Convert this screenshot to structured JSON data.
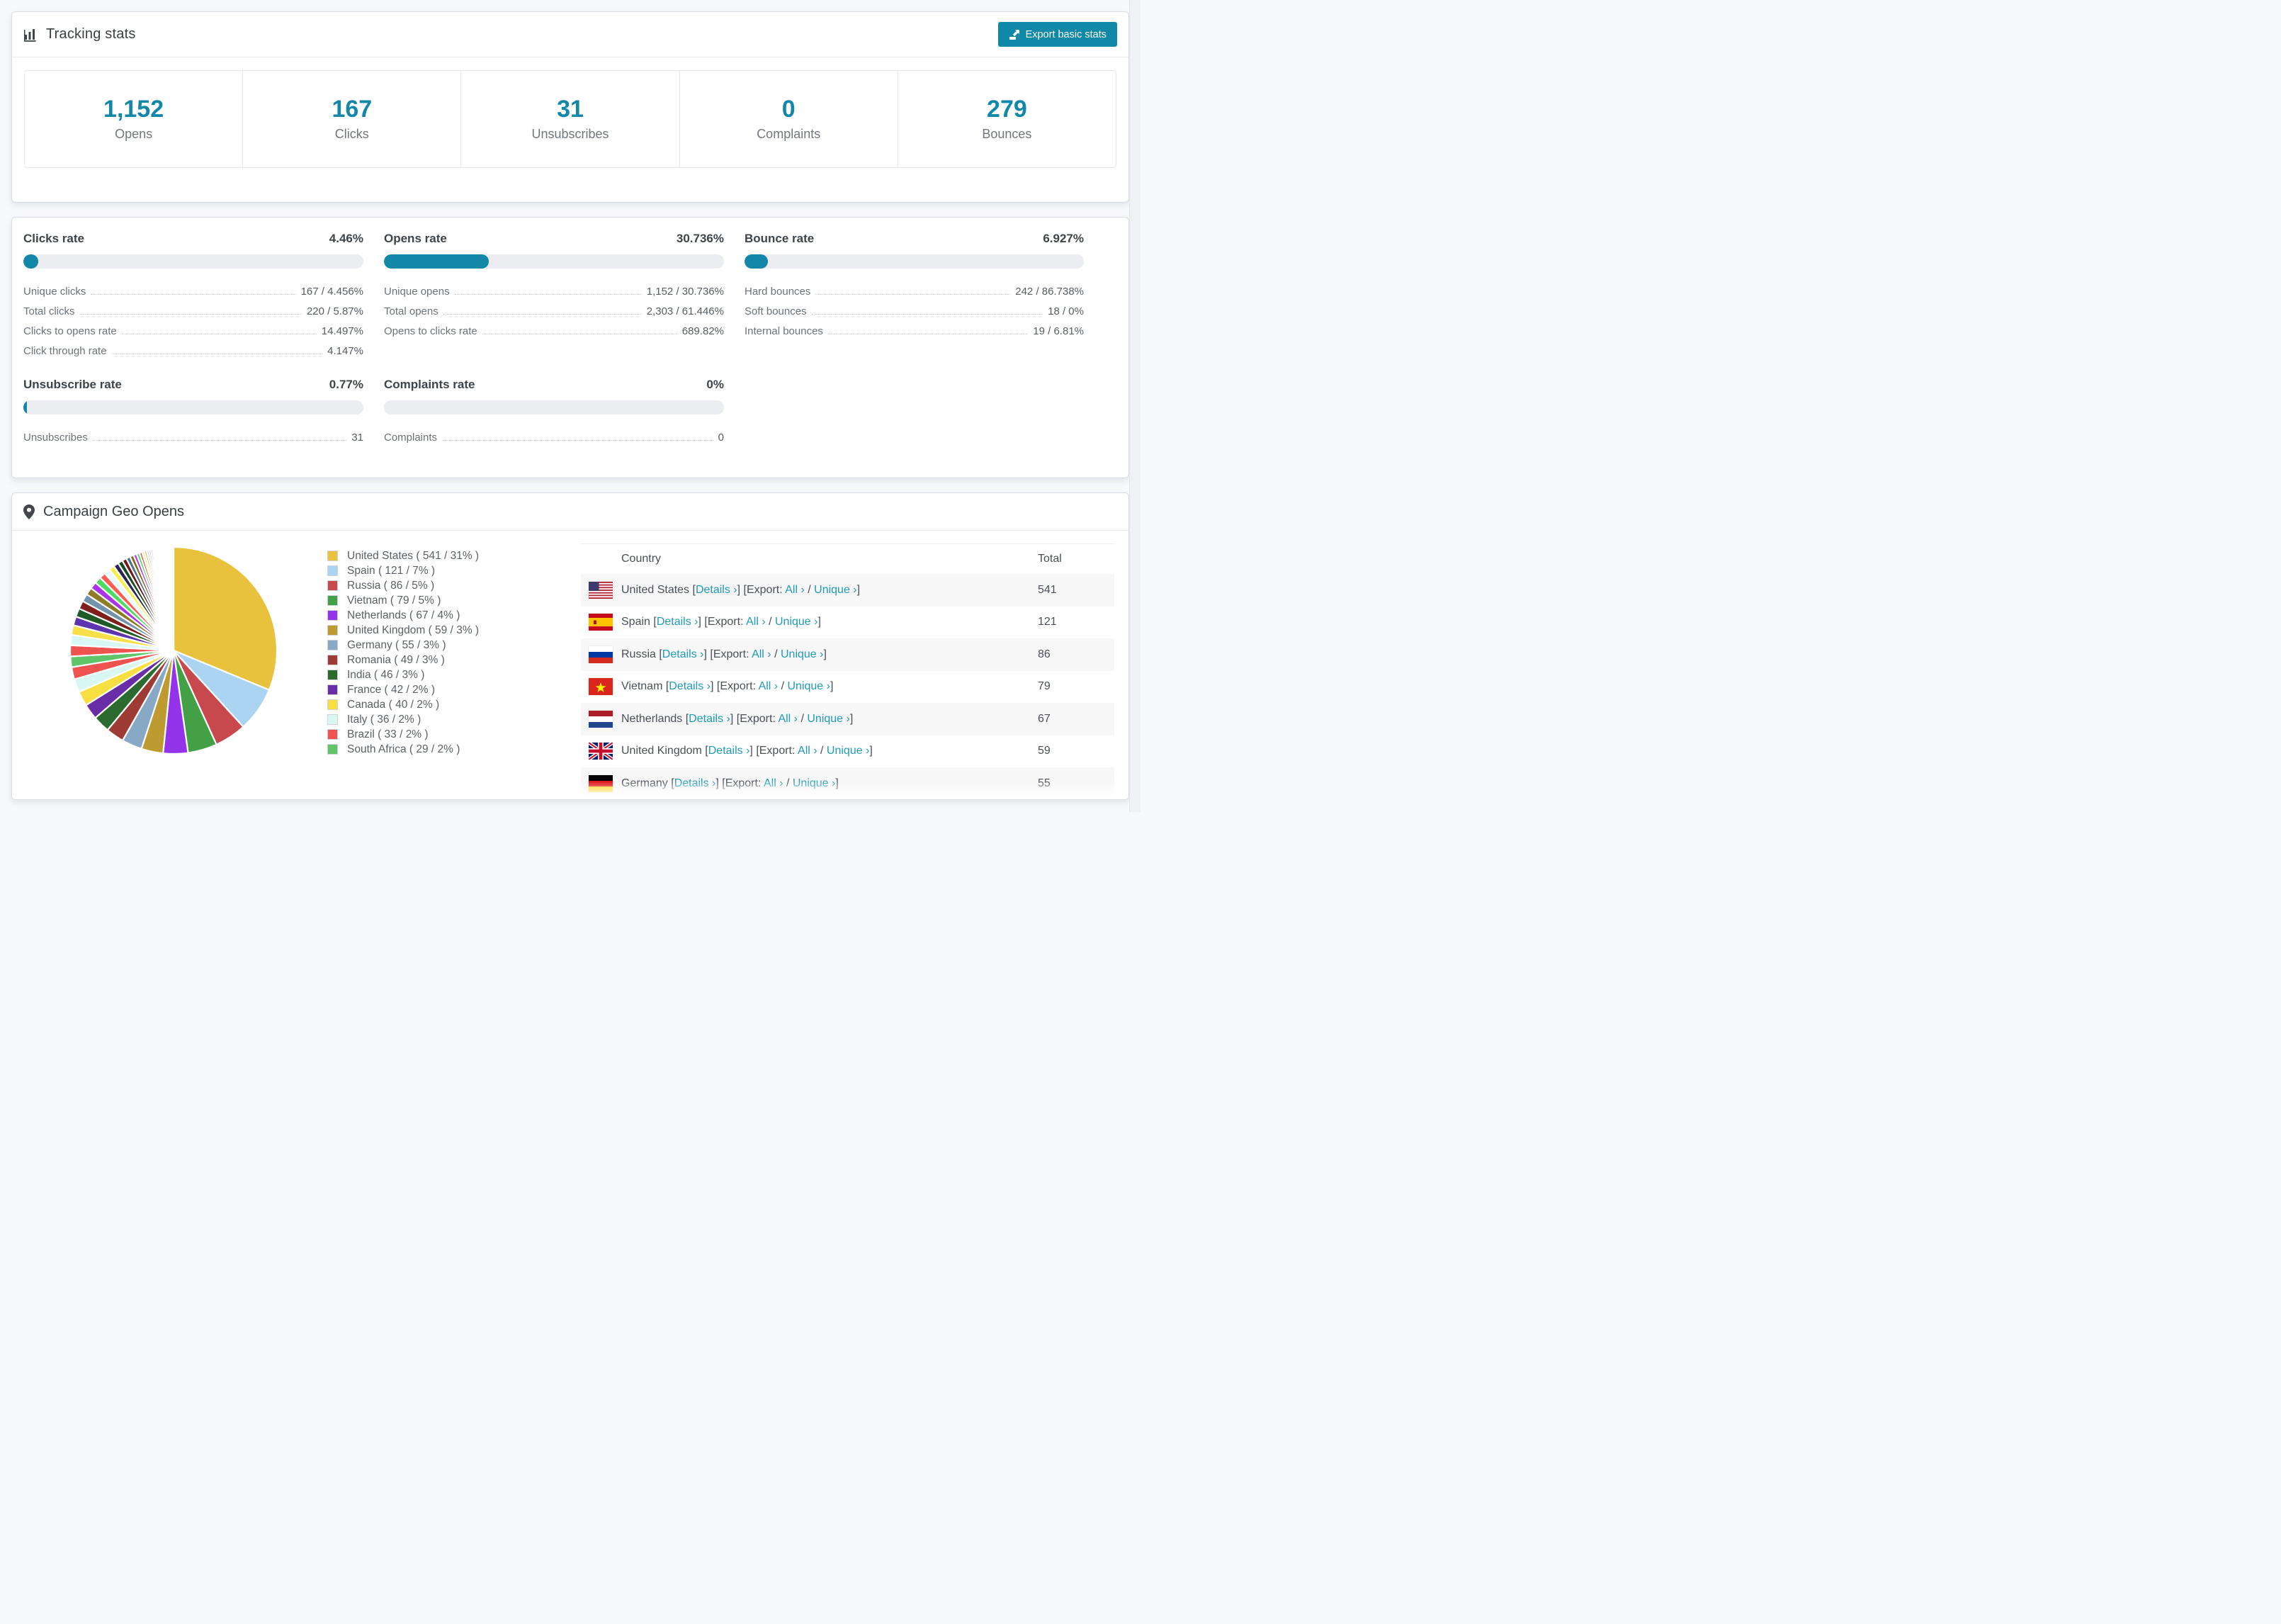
{
  "tracking": {
    "title": "Tracking stats",
    "export_button": "Export basic stats",
    "stats": [
      {
        "value": "1,152",
        "label": "Opens"
      },
      {
        "value": "167",
        "label": "Clicks"
      },
      {
        "value": "31",
        "label": "Unsubscribes"
      },
      {
        "value": "0",
        "label": "Complaints"
      },
      {
        "value": "279",
        "label": "Bounces"
      }
    ]
  },
  "rates": {
    "blocks": [
      {
        "id": "clicks-rate",
        "title": "Clicks rate",
        "value": "4.46%",
        "bar_pct": 4.46,
        "rows": [
          {
            "label": "Unique clicks",
            "value": "167 / 4.456%"
          },
          {
            "label": "Total clicks",
            "value": "220 / 5.87%"
          },
          {
            "label": "Clicks to opens rate",
            "value": "14.497%"
          },
          {
            "label": "Click through rate",
            "value": "4.147%"
          }
        ]
      },
      {
        "id": "opens-rate",
        "title": "Opens rate",
        "value": "30.736%",
        "bar_pct": 30.736,
        "rows": [
          {
            "label": "Unique opens",
            "value": "1,152 / 30.736%"
          },
          {
            "label": "Total opens",
            "value": "2,303 / 61.446%"
          },
          {
            "label": "Opens to clicks rate",
            "value": "689.82%"
          }
        ]
      },
      {
        "id": "bounce-rate",
        "title": "Bounce rate",
        "value": "6.927%",
        "bar_pct": 6.927,
        "rows": [
          {
            "label": "Hard bounces",
            "value": "242 / 86.738%"
          },
          {
            "label": "Soft bounces",
            "value": "18 / 0%"
          },
          {
            "label": "Internal bounces",
            "value": "19 / 6.81%"
          }
        ]
      },
      {
        "id": "unsubscribe-rate",
        "title": "Unsubscribe rate",
        "value": "0.77%",
        "bar_pct": 0.77,
        "rows": [
          {
            "label": "Unsubscribes",
            "value": "31"
          }
        ]
      },
      {
        "id": "complaints-rate",
        "title": "Complaints rate",
        "value": "0%",
        "bar_pct": 0,
        "rows": [
          {
            "label": "Complaints",
            "value": "0"
          }
        ]
      }
    ]
  },
  "chart_data": {
    "type": "pie",
    "title": "Campaign Geo Opens",
    "legend_position": "right",
    "start_angle": "top, clockwise",
    "categories": [
      "United States",
      "Spain",
      "Russia",
      "Vietnam",
      "Netherlands",
      "United Kingdom",
      "Germany",
      "Romania",
      "India",
      "France",
      "Canada",
      "Italy",
      "Brazil",
      "South Africa"
    ],
    "values": [
      541,
      121,
      86,
      79,
      67,
      59,
      55,
      49,
      46,
      42,
      40,
      36,
      33,
      29
    ],
    "percents": [
      31,
      7,
      5,
      5,
      4,
      3,
      3,
      3,
      3,
      2,
      2,
      2,
      2,
      2
    ],
    "colors": [
      "#e8c23d",
      "#abd3f2",
      "#c8494d",
      "#43a047",
      "#9333ea",
      "#bd9b31",
      "#87a9c6",
      "#9e3b35",
      "#2c6b30",
      "#6a2da8",
      "#f7df41",
      "#d8f7f3",
      "#ef5350",
      "#5fc568"
    ],
    "others_values": [
      30,
      28,
      26,
      24,
      23,
      22,
      21,
      20,
      19,
      18,
      17,
      16,
      15,
      14,
      13,
      12,
      11,
      10,
      9,
      8,
      7,
      7,
      6,
      6,
      5,
      5,
      4,
      4,
      3,
      3,
      3,
      3,
      2,
      2,
      2,
      2,
      2,
      2,
      2,
      2,
      2,
      1,
      1,
      1,
      1,
      1,
      1,
      1,
      1,
      1,
      1,
      1,
      1,
      1,
      1,
      1,
      1,
      1,
      1,
      1
    ],
    "others_colors": [
      "#ef5350",
      "#d9f7f4",
      "#f6e04a",
      "#5e35b1",
      "#1e5b25",
      "#7e1f1c",
      "#7193ab",
      "#8d7b25",
      "#a934e8",
      "#4cdb63",
      "#ff5c52",
      "#e8f9ff",
      "#f8ef4e",
      "#2a2550",
      "#174d23",
      "#6e1a1a",
      "#51708c",
      "#7c6a16",
      "#c73ae0",
      "#3fdf6b",
      "#e8403a",
      "#f6ef9b",
      "#d3b02b",
      "#a9cdef",
      "#8b5cf6",
      "#f06bf0",
      "#e23b4b",
      "#7ddc5a",
      "#caa32b",
      "#86b7e8",
      "#b44bf0",
      "#f57fc0",
      "#44c4f0",
      "#ffd84d",
      "#9e9e3c",
      "#4dd0c4",
      "#e88c3a",
      "#6fd6ff",
      "#c0e85a",
      "#d84da0"
    ]
  },
  "geo": {
    "title": "Campaign Geo Opens",
    "legend": [
      {
        "label": "United States ( 541 / 31% )",
        "color": "#e8c23d"
      },
      {
        "label": "Spain ( 121 / 7% )",
        "color": "#abd3f2"
      },
      {
        "label": "Russia ( 86 / 5% )",
        "color": "#c8494d"
      },
      {
        "label": "Vietnam ( 79 / 5% )",
        "color": "#43a047"
      },
      {
        "label": "Netherlands ( 67 / 4% )",
        "color": "#9333ea"
      },
      {
        "label": "United Kingdom ( 59 / 3% )",
        "color": "#bd9b31"
      },
      {
        "label": "Germany ( 55 / 3% )",
        "color": "#87a9c6"
      },
      {
        "label": "Romania ( 49 / 3% )",
        "color": "#9e3b35"
      },
      {
        "label": "India ( 46 / 3% )",
        "color": "#2c6b30"
      },
      {
        "label": "France ( 42 / 2% )",
        "color": "#6a2da8"
      },
      {
        "label": "Canada ( 40 / 2% )",
        "color": "#f7df41"
      },
      {
        "label": "Italy ( 36 / 2% )",
        "color": "#d8f7f3"
      },
      {
        "label": "Brazil ( 33 / 2% )",
        "color": "#ef5350"
      },
      {
        "label": "South Africa ( 29 / 2% )",
        "color": "#5fc568"
      }
    ],
    "table": {
      "columns": [
        "Country",
        "Total"
      ],
      "links": {
        "details": "Details ›",
        "export_prefix": "Export:",
        "all": "All ›",
        "unique": "Unique ›"
      },
      "rows": [
        {
          "flag": "us",
          "country": "United States",
          "total": "541"
        },
        {
          "flag": "es",
          "country": "Spain",
          "total": "121"
        },
        {
          "flag": "ru",
          "country": "Russia",
          "total": "86"
        },
        {
          "flag": "vn",
          "country": "Vietnam",
          "total": "79"
        },
        {
          "flag": "nl",
          "country": "Netherlands",
          "total": "67"
        },
        {
          "flag": "gb",
          "country": "United Kingdom",
          "total": "59"
        },
        {
          "flag": "de",
          "country": "Germany",
          "total": "55"
        }
      ]
    }
  },
  "colors": {
    "accent": "#1287a8",
    "link": "#1f9bb8",
    "bar_track": "#ecedf0"
  }
}
